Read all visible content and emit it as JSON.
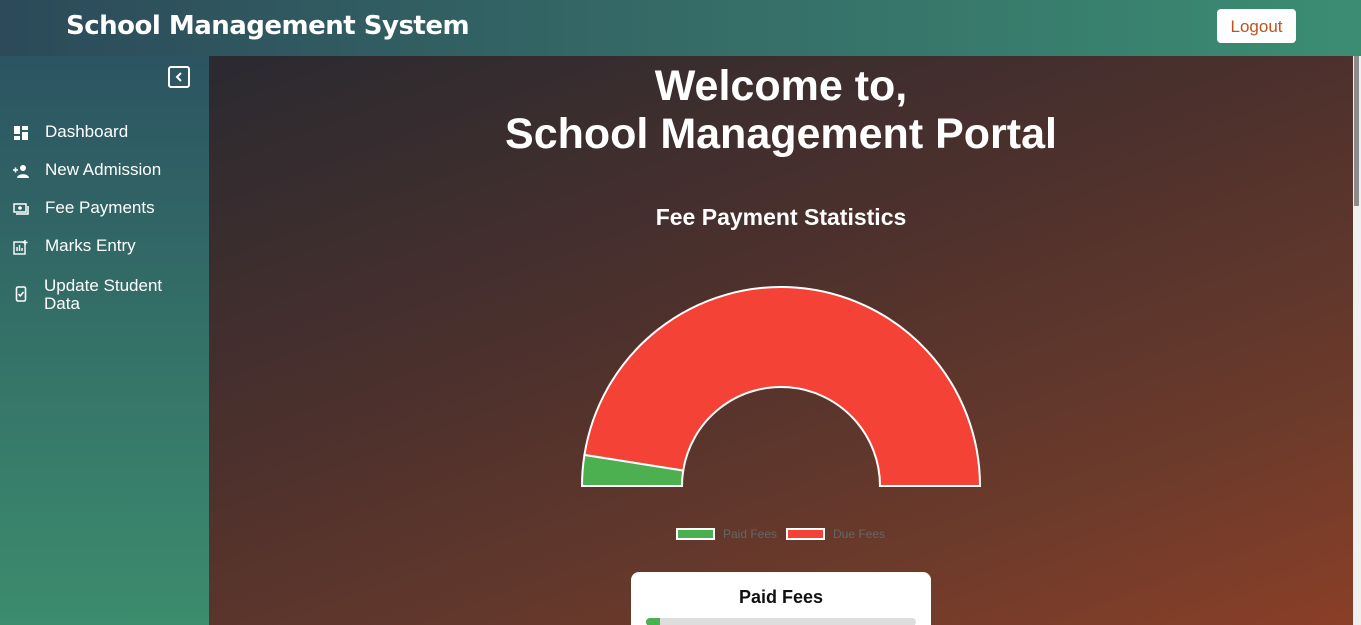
{
  "header": {
    "title": "School Management System",
    "logout_label": "Logout"
  },
  "sidebar": {
    "items": [
      {
        "label": "Dashboard",
        "icon": "dashboard-icon"
      },
      {
        "label": "New Admission",
        "icon": "person-add-icon"
      },
      {
        "label": "Fee Payments",
        "icon": "payments-icon"
      },
      {
        "label": "Marks Entry",
        "icon": "chart-add-icon"
      },
      {
        "label": "Update Student Data",
        "icon": "phone-check-icon"
      }
    ]
  },
  "main": {
    "welcome_line1": "Welcome to,",
    "welcome_line2": "School Management Portal",
    "paid_card": {
      "title": "Paid Fees",
      "progress_fraction": 0.05
    }
  },
  "chart_data": {
    "type": "pie",
    "subtype": "half-doughnut",
    "title": "Fee Payment Statistics",
    "categories": [
      "Paid Fees",
      "Due Fees"
    ],
    "values": [
      5,
      95
    ],
    "colors": [
      "#4caf50",
      "#f44336"
    ],
    "legend_position": "bottom"
  },
  "colors": {
    "accent": "#3b8d72",
    "paid": "#4caf50",
    "due": "#f44336",
    "logout_text": "#c0521c"
  }
}
